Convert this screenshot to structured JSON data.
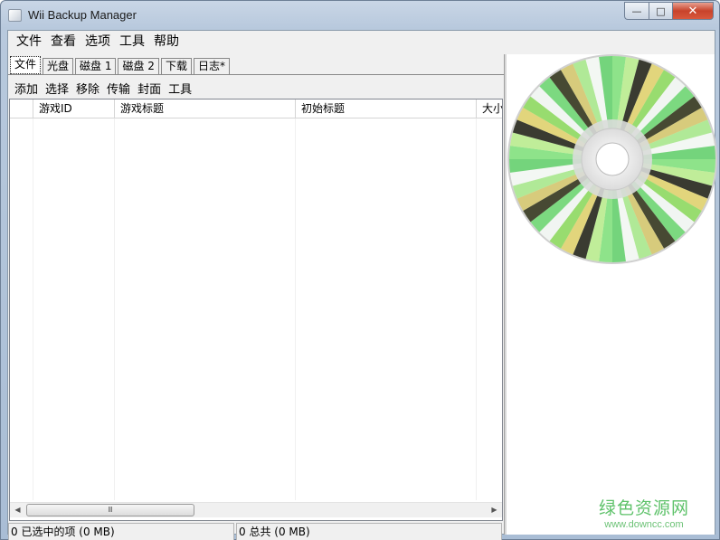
{
  "window": {
    "title": "Wii Backup Manager",
    "min": "—",
    "max": "□",
    "close": "✕"
  },
  "menu": [
    "文件",
    "查看",
    "选项",
    "工具",
    "帮助"
  ],
  "tabs": [
    "文件",
    "光盘",
    "磁盘 1",
    "磁盘 2",
    "下载",
    "日志*"
  ],
  "toolbar": [
    "添加",
    "选择",
    "移除",
    "传输",
    "封面",
    "工具"
  ],
  "table": {
    "columns": [
      "",
      "游戏ID",
      "游戏标题",
      "初始标题",
      "大小"
    ]
  },
  "scroll": {
    "left": "◀",
    "right": "▶",
    "thumb": "Ⅲ"
  },
  "status": {
    "selected": "0 已选中的项 (0 MB)",
    "total": "0 总共 (0 MB)"
  },
  "watermark": {
    "cn": "绿色资源网",
    "en": "www.downcc.com"
  }
}
